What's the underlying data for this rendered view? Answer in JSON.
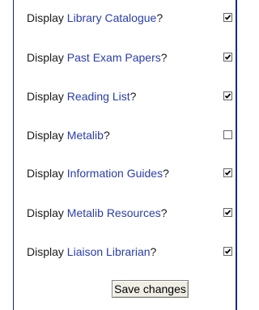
{
  "settings": {
    "rows": [
      {
        "prefix": "Display ",
        "link": "Library Catalogue",
        "suffix": "?",
        "checked": true
      },
      {
        "prefix": "Display ",
        "link": "Past Exam Papers",
        "suffix": "?",
        "checked": true
      },
      {
        "prefix": "Display ",
        "link": "Reading List",
        "suffix": "?",
        "checked": true
      },
      {
        "prefix": "Display ",
        "link": "Metalib",
        "suffix": "?",
        "checked": false
      },
      {
        "prefix": "Display ",
        "link": "Information Guides",
        "suffix": "?",
        "checked": true
      },
      {
        "prefix": "Display ",
        "link": "Metalib Resources",
        "suffix": "?",
        "checked": true
      },
      {
        "prefix": "Display ",
        "link": "Liaison Librarian",
        "suffix": "?",
        "checked": true
      }
    ]
  },
  "save_button": {
    "label": "Save changes"
  }
}
